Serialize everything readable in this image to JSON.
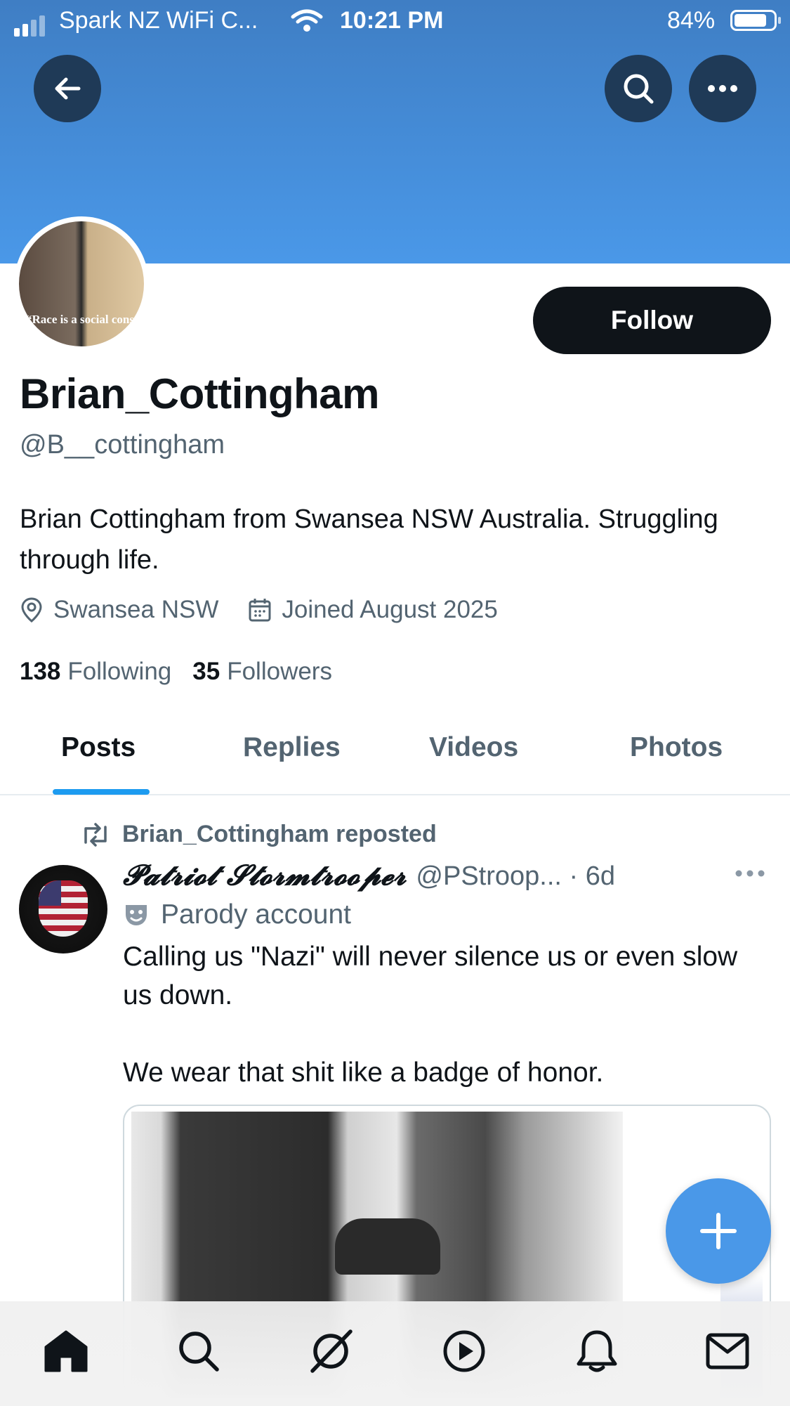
{
  "status_bar": {
    "carrier": "Spark NZ WiFi C...",
    "time": "10:21 PM",
    "battery_percent": "84%",
    "battery_level": 0.84
  },
  "header": {
    "back_icon": "arrow-left-icon",
    "search_icon": "search-icon",
    "more_icon": "more-horizontal-icon",
    "banner_color": "#4a98e8"
  },
  "profile": {
    "avatar_caption": "“Race is a social construct”",
    "follow_label": "Follow",
    "display_name": "Brian_Cottingham",
    "handle": "@B__cottingham",
    "bio": "Brian Cottingham from Swansea NSW Australia. Struggling through life.",
    "location": "Swansea NSW",
    "joined": "Joined August 2025",
    "following_count": "138",
    "following_label": "Following",
    "followers_count": "35",
    "followers_label": "Followers"
  },
  "tabs": [
    {
      "label": "Posts",
      "active": true
    },
    {
      "label": "Replies",
      "active": false
    },
    {
      "label": "Videos",
      "active": false
    },
    {
      "label": "Photos",
      "active": false
    }
  ],
  "post": {
    "repost_label": "Brian_Cottingham reposted",
    "author": "𝓟𝓪𝓽𝓻𝓲𝓸𝓽 𝓢𝓽𝓸𝓻𝓶𝓽𝓻𝓸𝓸𝓹𝓮𝓻",
    "handle_time": "@PStroop... · 6d",
    "parody_label": "Parody account",
    "text": "Calling us \"Nazi\" will never silence us or even slow us down.\n\nWe wear that shit like a badge of honor."
  },
  "fab": {
    "icon": "plus-icon"
  },
  "bottom_nav": {
    "items": [
      "home-icon",
      "search-icon",
      "grok-icon",
      "video-icon",
      "notifications-icon",
      "messages-icon"
    ]
  },
  "colors": {
    "accent": "#1d9bf0",
    "fab": "#4a98e8",
    "follow_button": "#0f1419",
    "secondary_text": "#536471"
  }
}
